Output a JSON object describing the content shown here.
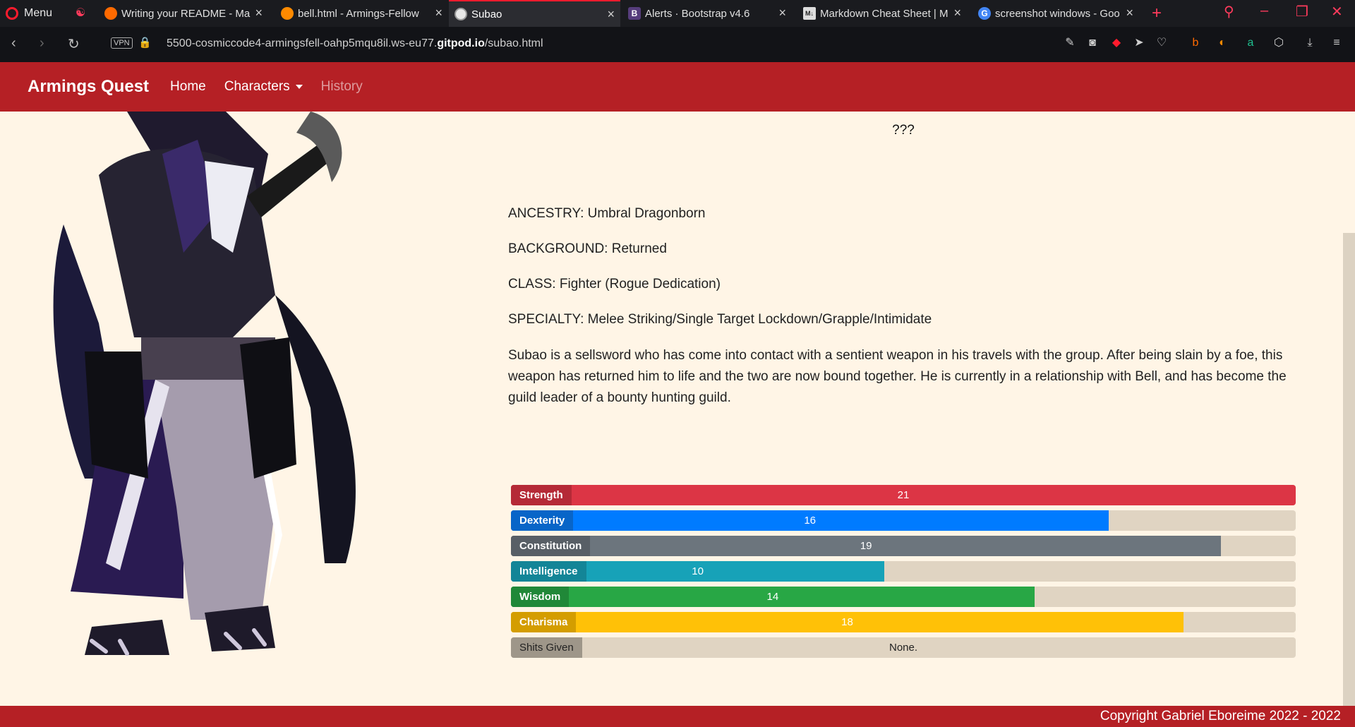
{
  "browser": {
    "menu_label": "Menu",
    "tabs": [
      {
        "title": "Writing your README - Ma",
        "favicon_color": "#ff6a00",
        "active": false
      },
      {
        "title": "bell.html - Armings-Fellow",
        "favicon_color": "#ff8a00",
        "active": false
      },
      {
        "title": "Subao",
        "favicon_color": "#f0f0f0",
        "active": true
      },
      {
        "title": "Alerts · Bootstrap v4.6",
        "favicon_color": "#563d7c",
        "active": false
      },
      {
        "title": "Markdown Cheat Sheet | M",
        "favicon_color": "#dddddd",
        "active": false
      },
      {
        "title": "screenshot windows - Goo",
        "favicon_color": "#4285f4",
        "active": false
      }
    ],
    "vpn_label": "VPN",
    "url_prefix": "5500-cosmiccode4-armingsfell-oahp5mqu8il.ws-eu77.",
    "url_domain": "gitpod.io",
    "url_suffix": "/subao.html"
  },
  "nav": {
    "brand": "Armings Quest",
    "links": [
      "Home",
      "Characters",
      "History"
    ]
  },
  "character": {
    "heading": "???",
    "ancestry": "ANCESTRY: Umbral Dragonborn",
    "background": "BACKGROUND: Returned",
    "class": "CLASS: Fighter (Rogue Dedication)",
    "specialty": "SPECIALTY: Melee Striking/Single Target Lockdown/Grapple/Intimidate",
    "bio": "Subao is a sellsword who has come into contact with a sentient weapon in his travels with the group. After being slain by a foe, this weapon has returned him to life and the two are now bound together. He is currently in a relationship with Bell, and has become the guild leader of a bounty hunting guild."
  },
  "stats": [
    {
      "label": "Strength",
      "value": "21",
      "fraction": 1.0,
      "color": "#dc3545",
      "label_bg": "#b52a37"
    },
    {
      "label": "Dexterity",
      "value": "16",
      "fraction": 0.762,
      "color": "#007bff",
      "label_bg": "#0865c8"
    },
    {
      "label": "Constitution",
      "value": "19",
      "fraction": 0.905,
      "color": "#6c757d",
      "label_bg": "#585f66"
    },
    {
      "label": "Intelligence",
      "value": "10",
      "fraction": 0.476,
      "color": "#17a2b8",
      "label_bg": "#138597"
    },
    {
      "label": "Wisdom",
      "value": "14",
      "fraction": 0.667,
      "color": "#28a745",
      "label_bg": "#208838"
    },
    {
      "label": "Charisma",
      "value": "18",
      "fraction": 0.857,
      "color": "#ffc107",
      "label_bg": "#d49d00"
    },
    {
      "label": "Shits Given",
      "value": "None.",
      "fraction": 0.0,
      "color": "#e0d4c2",
      "label_bg": "#9e9689"
    }
  ],
  "footer": "Copyright Gabriel Eboreime 2022 - 2022"
}
